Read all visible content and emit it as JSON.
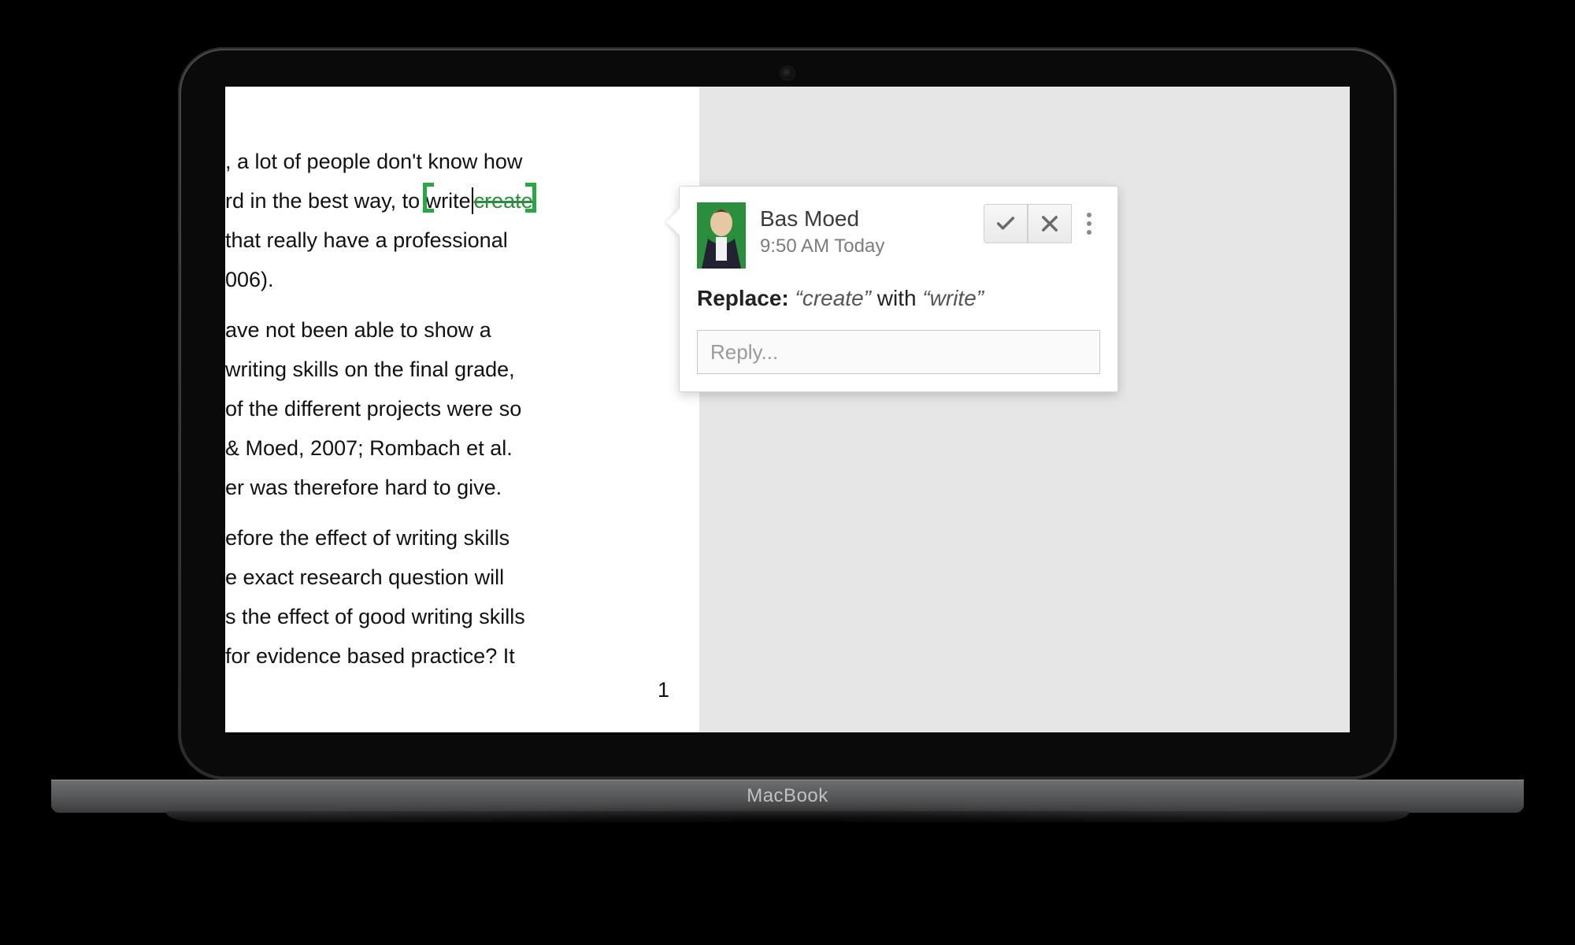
{
  "device": {
    "label": "MacBook"
  },
  "document": {
    "page_number": "1",
    "suggestion": {
      "insert": "write",
      "strike": "create"
    },
    "lines": {
      "l1_a": ", a lot of people don't know how",
      "l2_a": "rd in the best way, to ",
      "l3": "that really have a professional",
      "l4": "006).",
      "l5": "ave not been able to show a",
      "l6": " writing skills on the final grade,",
      "l7": " of the different projects were so",
      "l8": "& Moed, 2007; Rombach et al.",
      "l9": "er was therefore hard to give.",
      "l10": "efore the effect of writing skills",
      "l11": "e exact research question will",
      "l12": "s the effect of good writing skills",
      "l13": "for evidence based practice? It"
    }
  },
  "comment": {
    "author": "Bas Moed",
    "timestamp": "9:50 AM Today",
    "action_label": "Replace:",
    "from_text": "“create”",
    "join": "with",
    "to_text": "“write”",
    "reply_placeholder": "Reply..."
  }
}
